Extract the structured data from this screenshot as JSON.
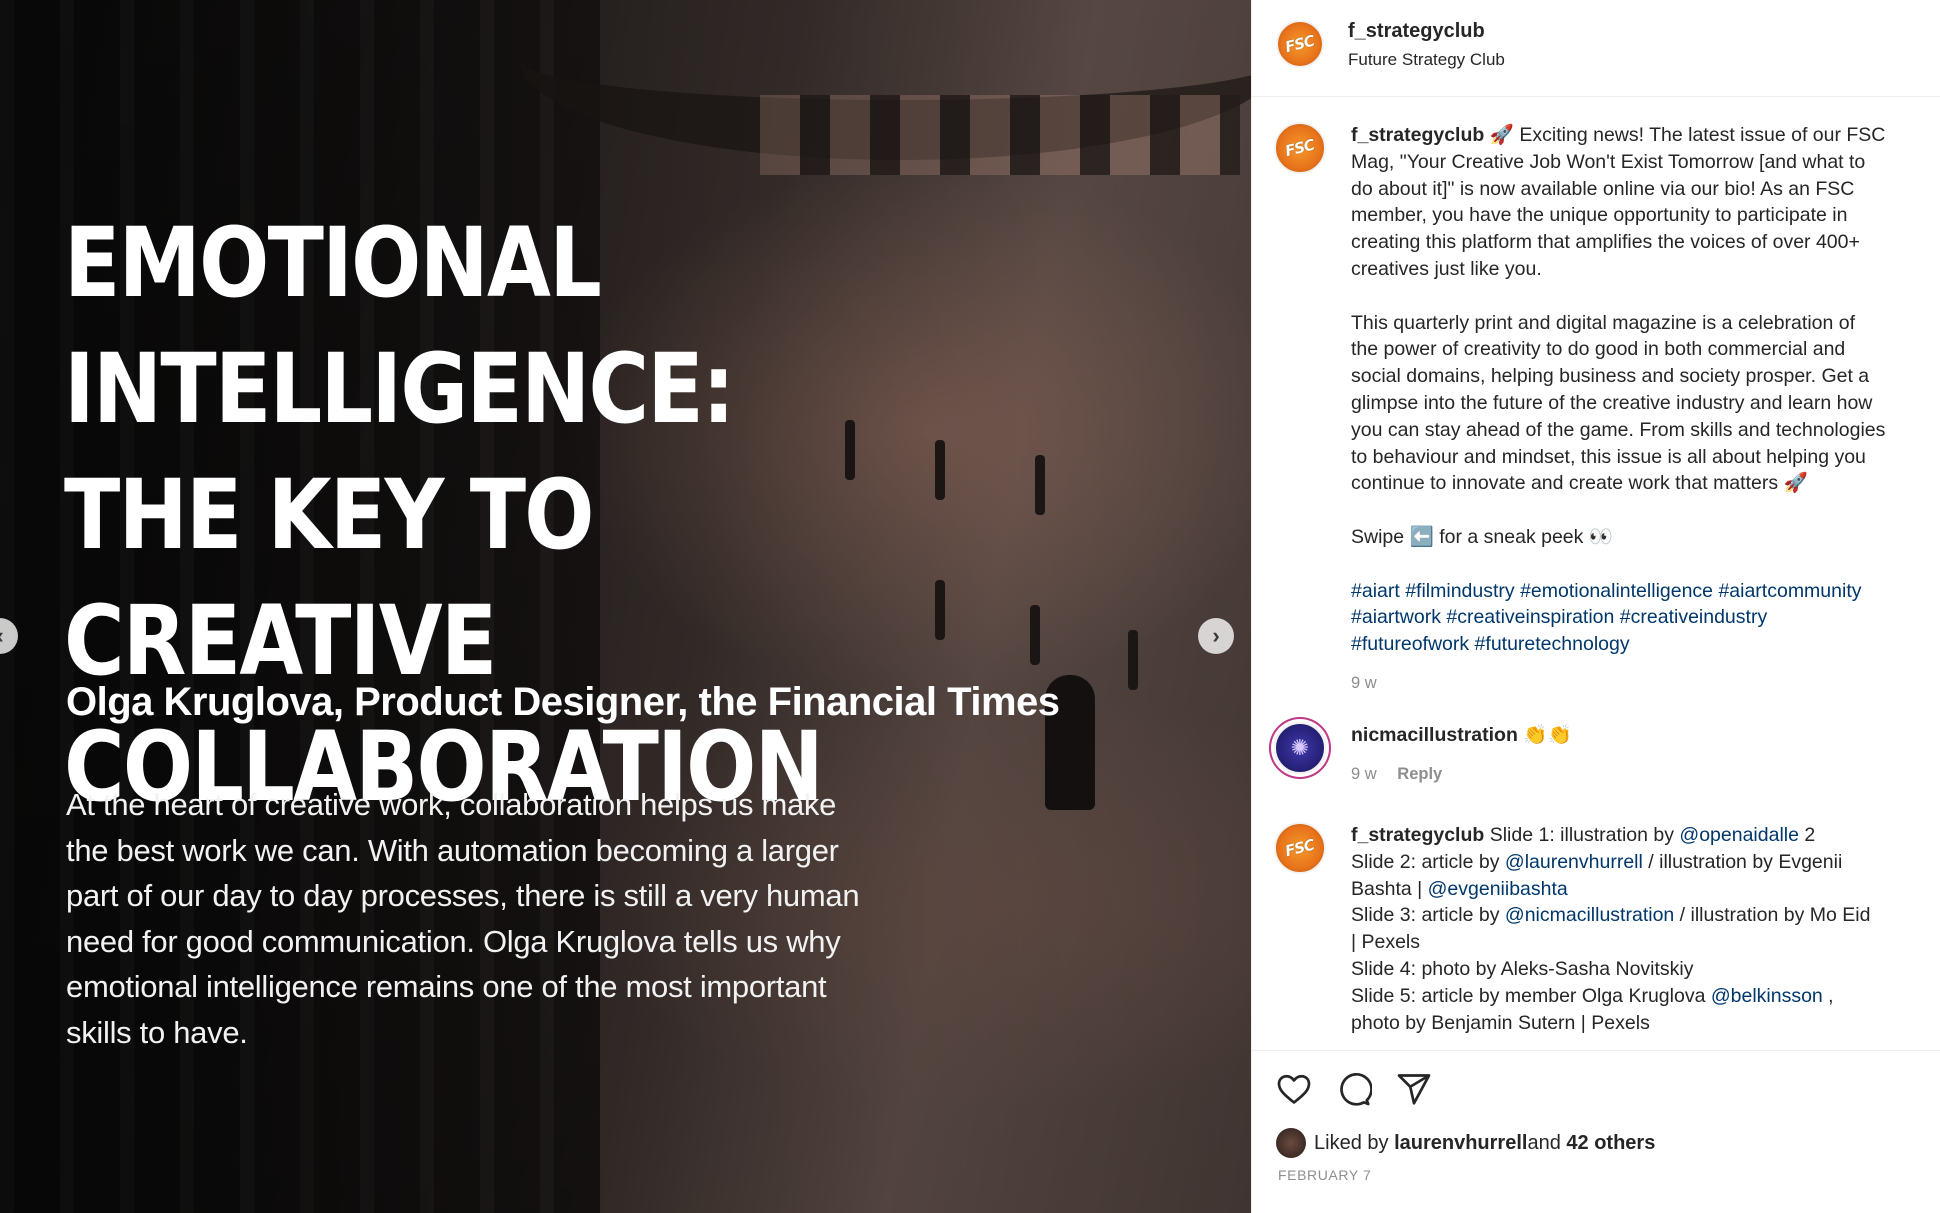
{
  "media": {
    "headline_lines": [
      "EMOTIONAL INTELLIGENCE:",
      "THE KEY TO CREATIVE",
      "COLLABORATION"
    ],
    "byline": "Olga Kruglova, Product Designer, the Financial Times",
    "intro_lines": [
      "At the heart of creative work, collaboration helps us make",
      "the best work we can. With automation becoming a larger",
      "part of our day to day processes, there is still a very human",
      "need for good communication. Olga Kruglova tells us why",
      "emotional intelligence remains one of the most important",
      "skills to have."
    ],
    "next_icon": "chevron-right-icon",
    "prev_icon": "chevron-left-icon"
  },
  "header": {
    "username": "f_strategyclub",
    "subtitle": "Future Strategy Club",
    "avatar_text": "FSC"
  },
  "caption": {
    "username": "f_strategyclub",
    "p1_lines": [
      " 🚀 Exciting news! The latest issue of our FSC",
      "Mag, \"Your Creative Job Won't Exist Tomorrow [and what to",
      "do about it]\" is now available online via our bio! As an FSC",
      "member, you have the unique opportunity to participate in",
      "creating this platform that amplifies the voices of over 400+",
      "creatives just like you."
    ],
    "p2_lines": [
      "This quarterly print and digital magazine is a celebration of",
      "the power of creativity to do good in both commercial and",
      "social domains, helping business and society prosper. Get a",
      "glimpse into the future of the creative industry and learn how",
      "you can stay ahead of the game. From skills and technologies",
      "to behaviour and mindset, this issue is all about helping you",
      "continue to innovate and create work that matters 🚀"
    ],
    "swipe": "Swipe ⬅️ for a sneak peek 👀",
    "hashtags_lines": [
      "#aiart #filmindustry #emotionalintelligence #aiartcommunity",
      "#aiartwork #creativeinspiration #creativeindustry",
      "#futureofwork #futuretechnology"
    ],
    "age": "9 w"
  },
  "comment_nic": {
    "username": "nicmacillustration",
    "text": " 👏👏",
    "age": "9 w",
    "reply": "Reply"
  },
  "comment_credits": {
    "username": "f_strategyclub",
    "l1_text": " Slide 1: illustration by ",
    "l1_mention": "@openaidalle",
    "l1_tail": " 2",
    "l2_text": "Slide 2: article by ",
    "l2_mention": "@laurenvhurrell",
    "l2_tail": " / illustration by Evgenii",
    "l3_text": "Bashta | ",
    "l3_mention": "@evgeniibashta",
    "l4_text": "Slide 3: article by ",
    "l4_mention": "@nicmacillustration",
    "l4_tail": " / illustration by Mo Eid",
    "l5_text": "| Pexels",
    "l6_text": "Slide 4: photo by Aleks-Sasha Novitskiy",
    "l7_text": "Slide 5: article by member Olga Kruglova ",
    "l7_mention": "@belkinsson",
    "l7_tail": " ,",
    "l8_text": "photo by Benjamin Sutern | Pexels"
  },
  "actions": {
    "like_icon": "heart-icon",
    "comment_icon": "comment-icon",
    "share_icon": "share-icon",
    "liked_prefix": "Liked by ",
    "liked_user": "laurenvhurrell",
    "liked_mid": " and ",
    "liked_others": "42 others",
    "date": "FEBRUARY 7"
  },
  "colors": {
    "link": "#00376b",
    "muted": "#8e8e8e",
    "avatar_orange": "#e8731b"
  }
}
